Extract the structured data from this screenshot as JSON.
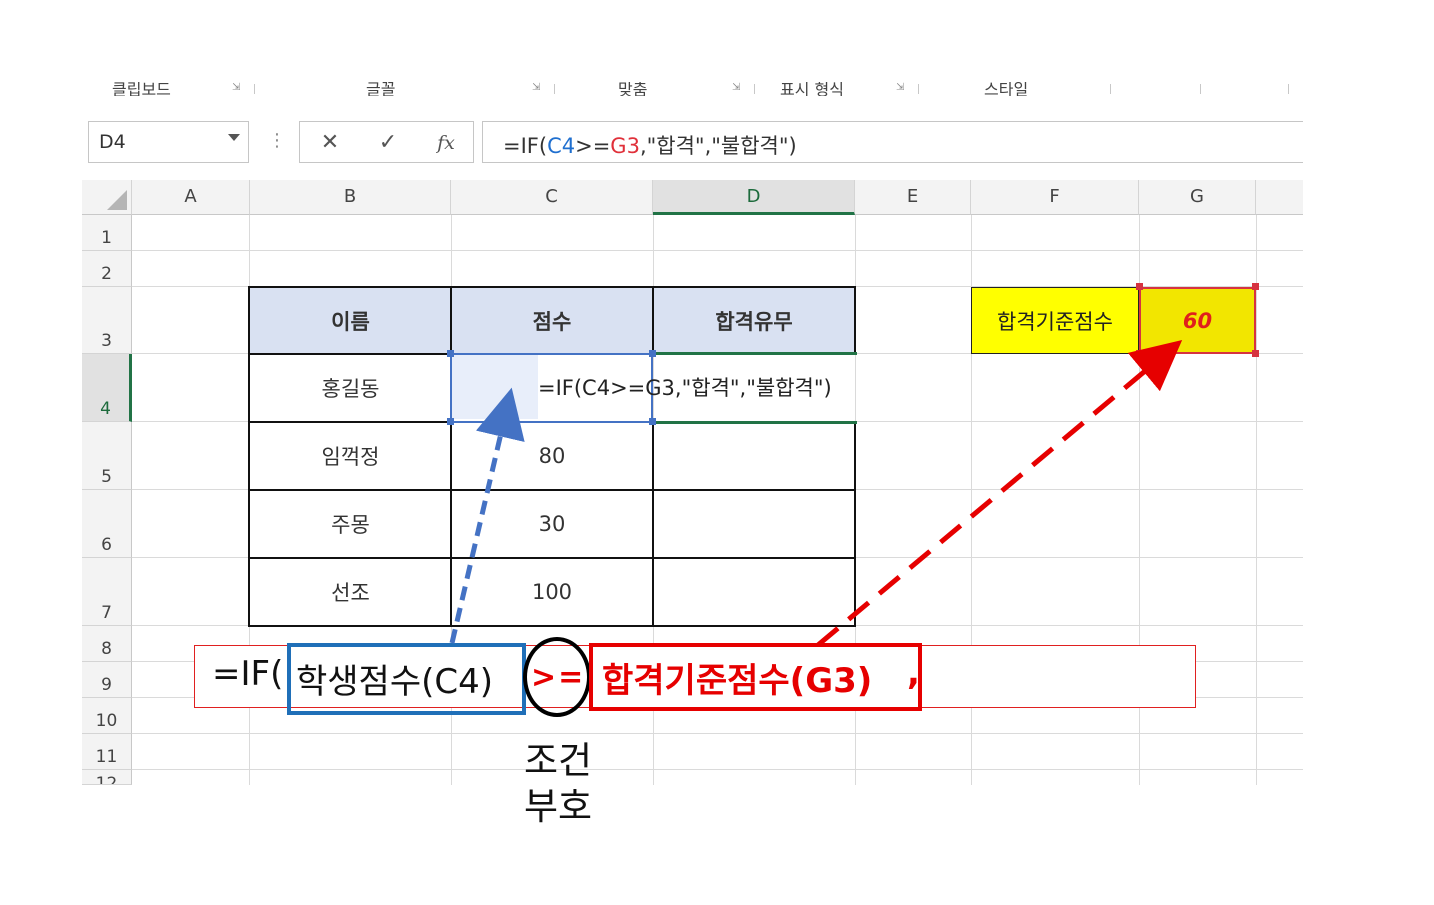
{
  "ribbon": {
    "groups": [
      "클립보드",
      "글꼴",
      "맞춤",
      "표시 형식",
      "스타일"
    ]
  },
  "formula_bar": {
    "name_box": "D4",
    "cancel_icon": "✕",
    "enter_icon": "✓",
    "fx_label": "fx",
    "formula_parts": [
      "=IF(",
      "C4",
      ">=",
      "G3",
      ",\"합격\",\"불합격\")"
    ]
  },
  "sheet": {
    "columns": [
      "A",
      "B",
      "C",
      "D",
      "E",
      "F",
      "G"
    ],
    "selected_column": "D",
    "rows": [
      "1",
      "2",
      "3",
      "4",
      "5",
      "6",
      "7",
      "8",
      "9",
      "10",
      "11",
      "12"
    ],
    "selected_row": "4",
    "table": {
      "headers": [
        "이름",
        "점수",
        "합격유무"
      ],
      "rows": [
        {
          "name": "홍길동",
          "score": "",
          "result": ""
        },
        {
          "name": "임꺽정",
          "score": "80",
          "result": ""
        },
        {
          "name": "주몽",
          "score": "30",
          "result": ""
        },
        {
          "name": "선조",
          "score": "100",
          "result": ""
        }
      ]
    },
    "editing_formula": "=IF(C4>=G3,\"합격\",\"불합격\")",
    "criteria_label": "합격기준점수",
    "criteria_value": "60"
  },
  "annotation": {
    "prefix": "=IF(",
    "student_score": "학생점수(C4)",
    "operator": ">=",
    "criteria": "합격기준점수(G3)",
    "comma": ",",
    "condition_label_line1": "조건",
    "condition_label_line2": "부호"
  },
  "colors": {
    "header_fill": "#d9e1f2",
    "criteria_fill": "#ffff00",
    "accent_red": "#e60000",
    "accent_blue": "#1f6fb8",
    "excel_green": "#217346"
  }
}
